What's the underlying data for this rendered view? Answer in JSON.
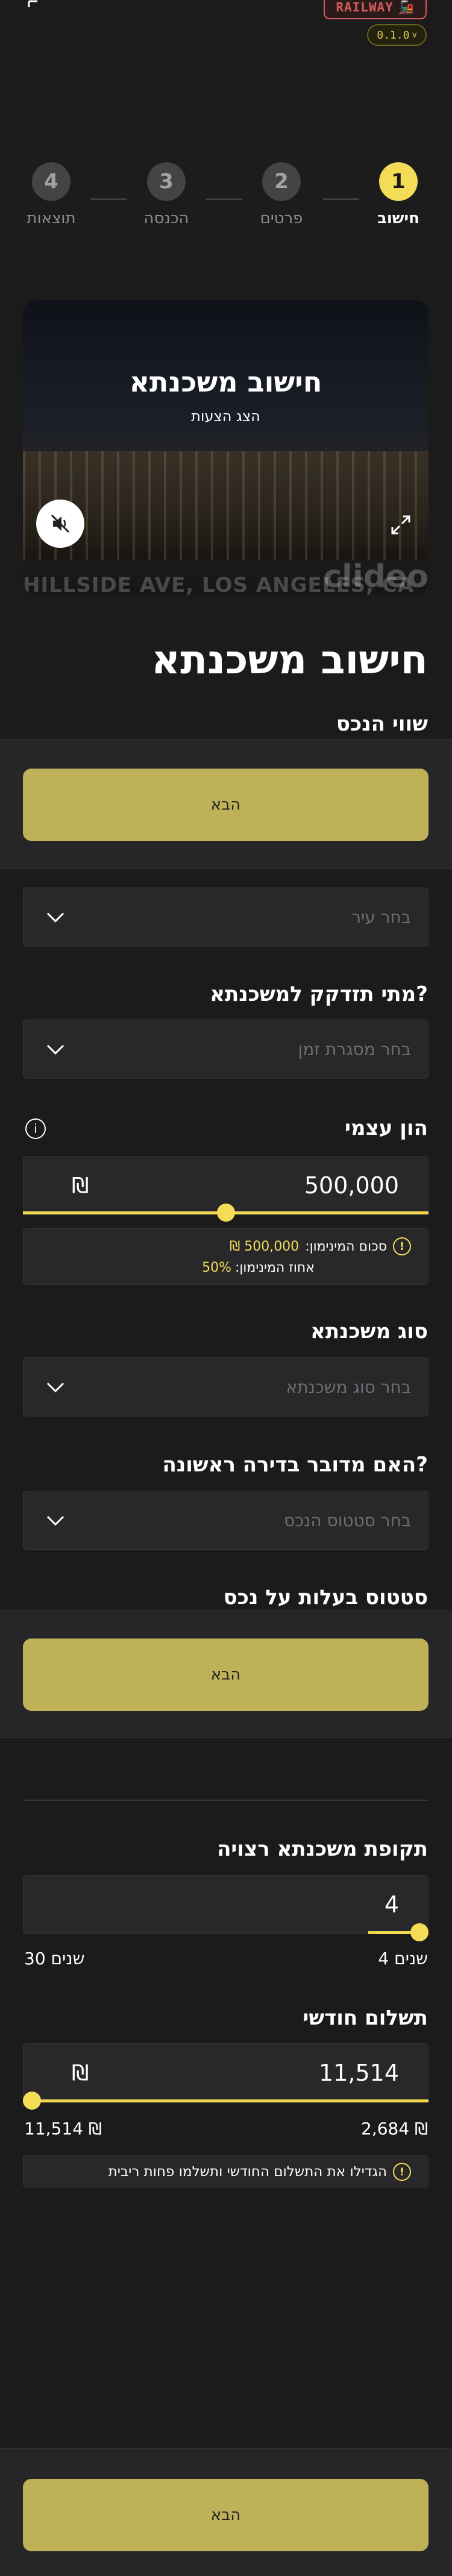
{
  "header": {
    "railway_label": "RAILWAY",
    "version": "0.1.0"
  },
  "stepper": {
    "steps": [
      {
        "number": "1",
        "label": "חישוב"
      },
      {
        "number": "2",
        "label": "פרטים"
      },
      {
        "number": "3",
        "label": "הכנסה"
      },
      {
        "number": "4",
        "label": "תוצאות"
      }
    ],
    "active_step": 1
  },
  "video": {
    "title": "חישוב משכנתא",
    "subtitle": "הצג הצעות",
    "address": "HILLSIDE AVE, LOS ANGELES, CA",
    "brand": "clideo"
  },
  "page_title": "חישוב משכנתא",
  "property_value_label": "שווי הנכס",
  "next_label": "הבא",
  "city": {
    "placeholder": "בחר עיר"
  },
  "timeframe": {
    "label": "מתי תזדקק למשכנתא?",
    "placeholder": "בחר מסגרת זמן"
  },
  "equity": {
    "label": "הון עצמי",
    "value": "500,000",
    "currency": "₪",
    "slider_fraction": 0.5,
    "min_amount_text": "סכום המינימון:",
    "min_amount_value": "500,000 ₪",
    "min_percent_text": "אחוז המינימון:",
    "min_percent_value": "50%"
  },
  "mortgage_type": {
    "label": "סוג משכנתא",
    "placeholder": "בחר סוג משכנתא"
  },
  "first_apartment": {
    "label": "האם מדובר בדירה ראשונה?",
    "placeholder": "בחר סטטוס הנכס"
  },
  "ownership_status": {
    "label": "סטטוס בעלות על נכס"
  },
  "period": {
    "label": "תקופת משכנתא רצויה",
    "value": "4",
    "slider_fraction": 0.0,
    "min_label": "4 שנים",
    "max_label": "30 שנים"
  },
  "monthly": {
    "label": "תשלום חודשי",
    "value": "11,514",
    "currency": "₪",
    "slider_fraction": 1.0,
    "min_label": "2,684 ₪",
    "max_label": "11,514 ₪",
    "tip": "הגדילו את התשלום החודשי ותשלמו פחות ריבית"
  },
  "colors": {
    "accent": "#f4dc57",
    "button": "#bfb158",
    "background": "#1b1b1c"
  }
}
